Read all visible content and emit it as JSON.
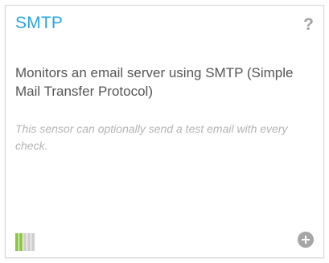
{
  "card": {
    "title": "SMTP",
    "help_label": "?",
    "description": "Monitors an email server using SMTP (Simple Mail Transfer Protocol)",
    "note": "This sensor can optionally send a test email with every check.",
    "performance_impact": {
      "level": 2,
      "max": 5,
      "active_color": "#8dc63f",
      "inactive_color": "#cfcfcf"
    },
    "add_icon": "plus-circle-icon",
    "help_icon": "question-mark-icon",
    "title_color": "#2aa6de"
  }
}
